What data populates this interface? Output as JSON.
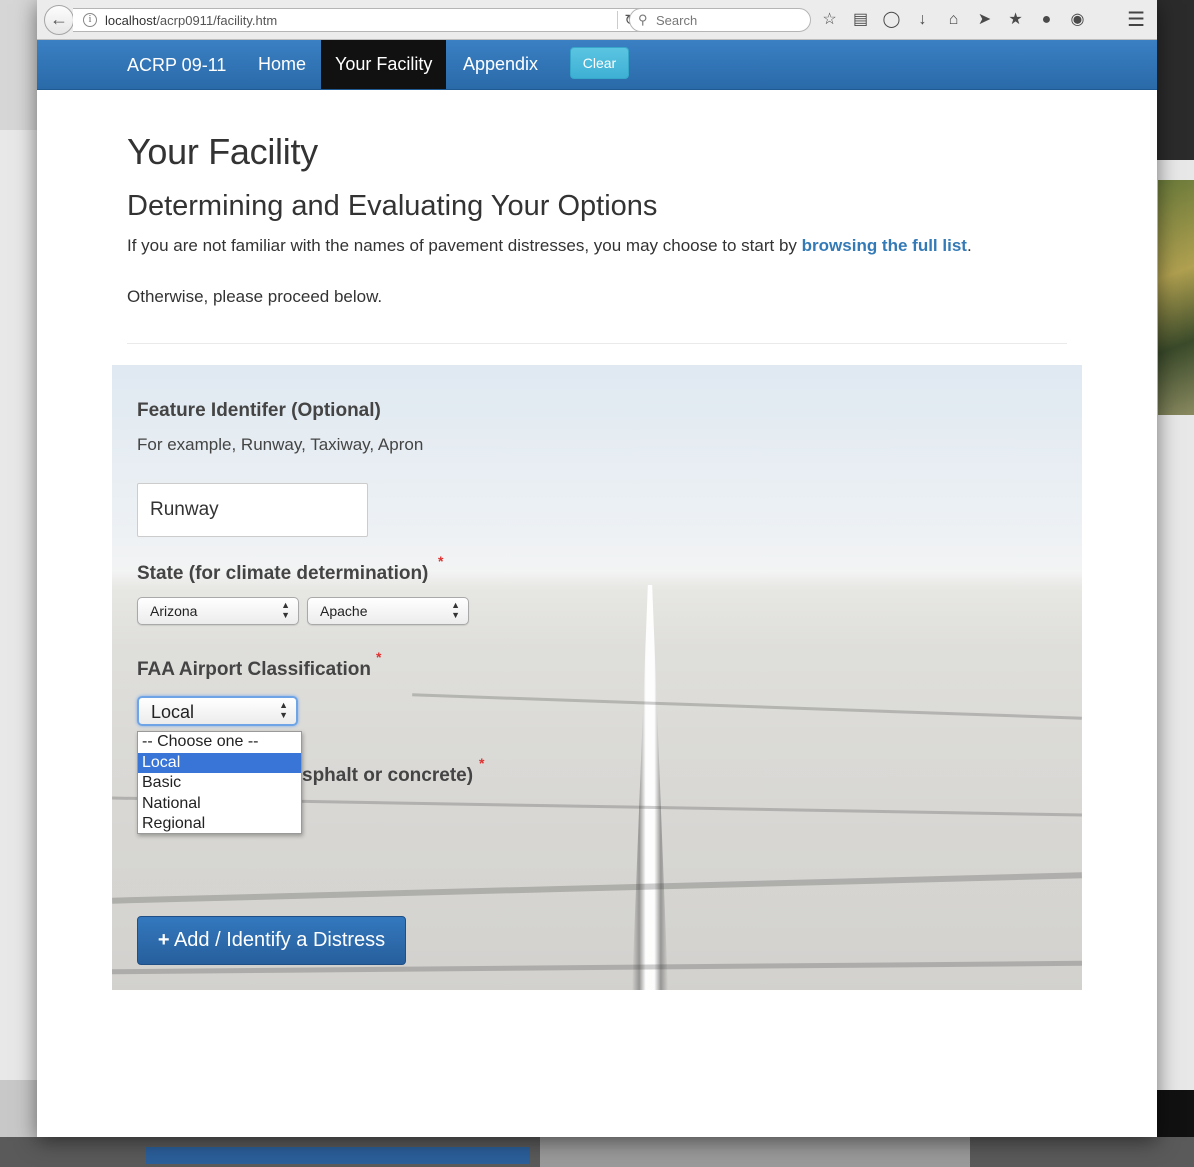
{
  "browser": {
    "url_host": "localhost",
    "url_path": "/acrp0911/facility.htm",
    "search_placeholder": "Search"
  },
  "navbar": {
    "brand": "ACRP 09-11",
    "items": [
      {
        "label": "Home",
        "active": false
      },
      {
        "label": "Your Facility",
        "active": true
      },
      {
        "label": "Appendix",
        "active": false
      }
    ],
    "clear_label": "Clear",
    "active_bg": "#111111",
    "bar_color": "#2f74b5"
  },
  "page": {
    "title": "Your Facility",
    "subtitle": "Determining and Evaluating Your Options",
    "intro_prefix": "If you are not familiar with the names of pavement distresses, you may choose to start by ",
    "intro_link": "browsing the full list",
    "intro_suffix": ".",
    "otherwise": "Otherwise, please proceed below."
  },
  "form": {
    "feature_label": "Feature Identifer (Optional)",
    "feature_help": "For example, Runway, Taxiway, Apron",
    "feature_value": "Runway",
    "state_label": "State (for climate determination)",
    "state_value": "Arizona",
    "county_value": "Apache",
    "faa_label": "FAA Airport Classification",
    "faa_value": "Local",
    "faa_options": [
      "-- Choose one --",
      "Local",
      "Basic",
      "National",
      "Regional"
    ],
    "faa_highlighted_index": 1,
    "pavement_label_visible": "sphalt or concrete)",
    "required_mark": "*",
    "add_button": "Add / Identify a Distress"
  }
}
